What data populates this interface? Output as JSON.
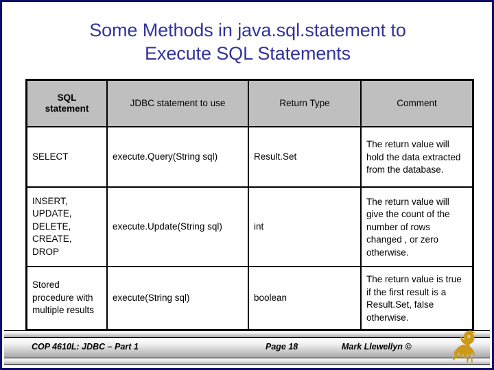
{
  "slide": {
    "title_line_1": "Some Methods in java.sql.statement to",
    "title_line_2": "Execute SQL Statements",
    "border_color": "#0d0d6b",
    "title_color": "#33339c"
  },
  "table": {
    "header_background": "#bfbfbf",
    "headers": [
      "SQL\nstatement",
      "JDBC statement to use",
      "Return Type",
      "Comment"
    ],
    "rows": [
      {
        "sql_statement": "SELECT",
        "jdbc_statement": "execute.Query(String sql)",
        "return_type": "Result.Set",
        "comment": "The return value will hold the data extracted from the database."
      },
      {
        "sql_statement": "INSERT,\nUPDATE,\nDELETE,\nCREATE,\nDROP",
        "jdbc_statement": "execute.Update(String sql)",
        "return_type": "int",
        "comment": "The return value will give the count of the number of rows changed , or zero otherwise."
      },
      {
        "sql_statement": "Stored procedure with multiple results",
        "jdbc_statement": "execute(String sql)",
        "return_type": "boolean",
        "comment": "The return value is true if the first result is a Result.Set, false otherwise."
      }
    ]
  },
  "footer": {
    "course": "COP 4610L: JDBC – Part 1",
    "page": "Page 18",
    "author": "Mark Llewellyn ©",
    "logo_name": "ucf-pegasus-logo",
    "logo_color": "#cc9a18"
  }
}
